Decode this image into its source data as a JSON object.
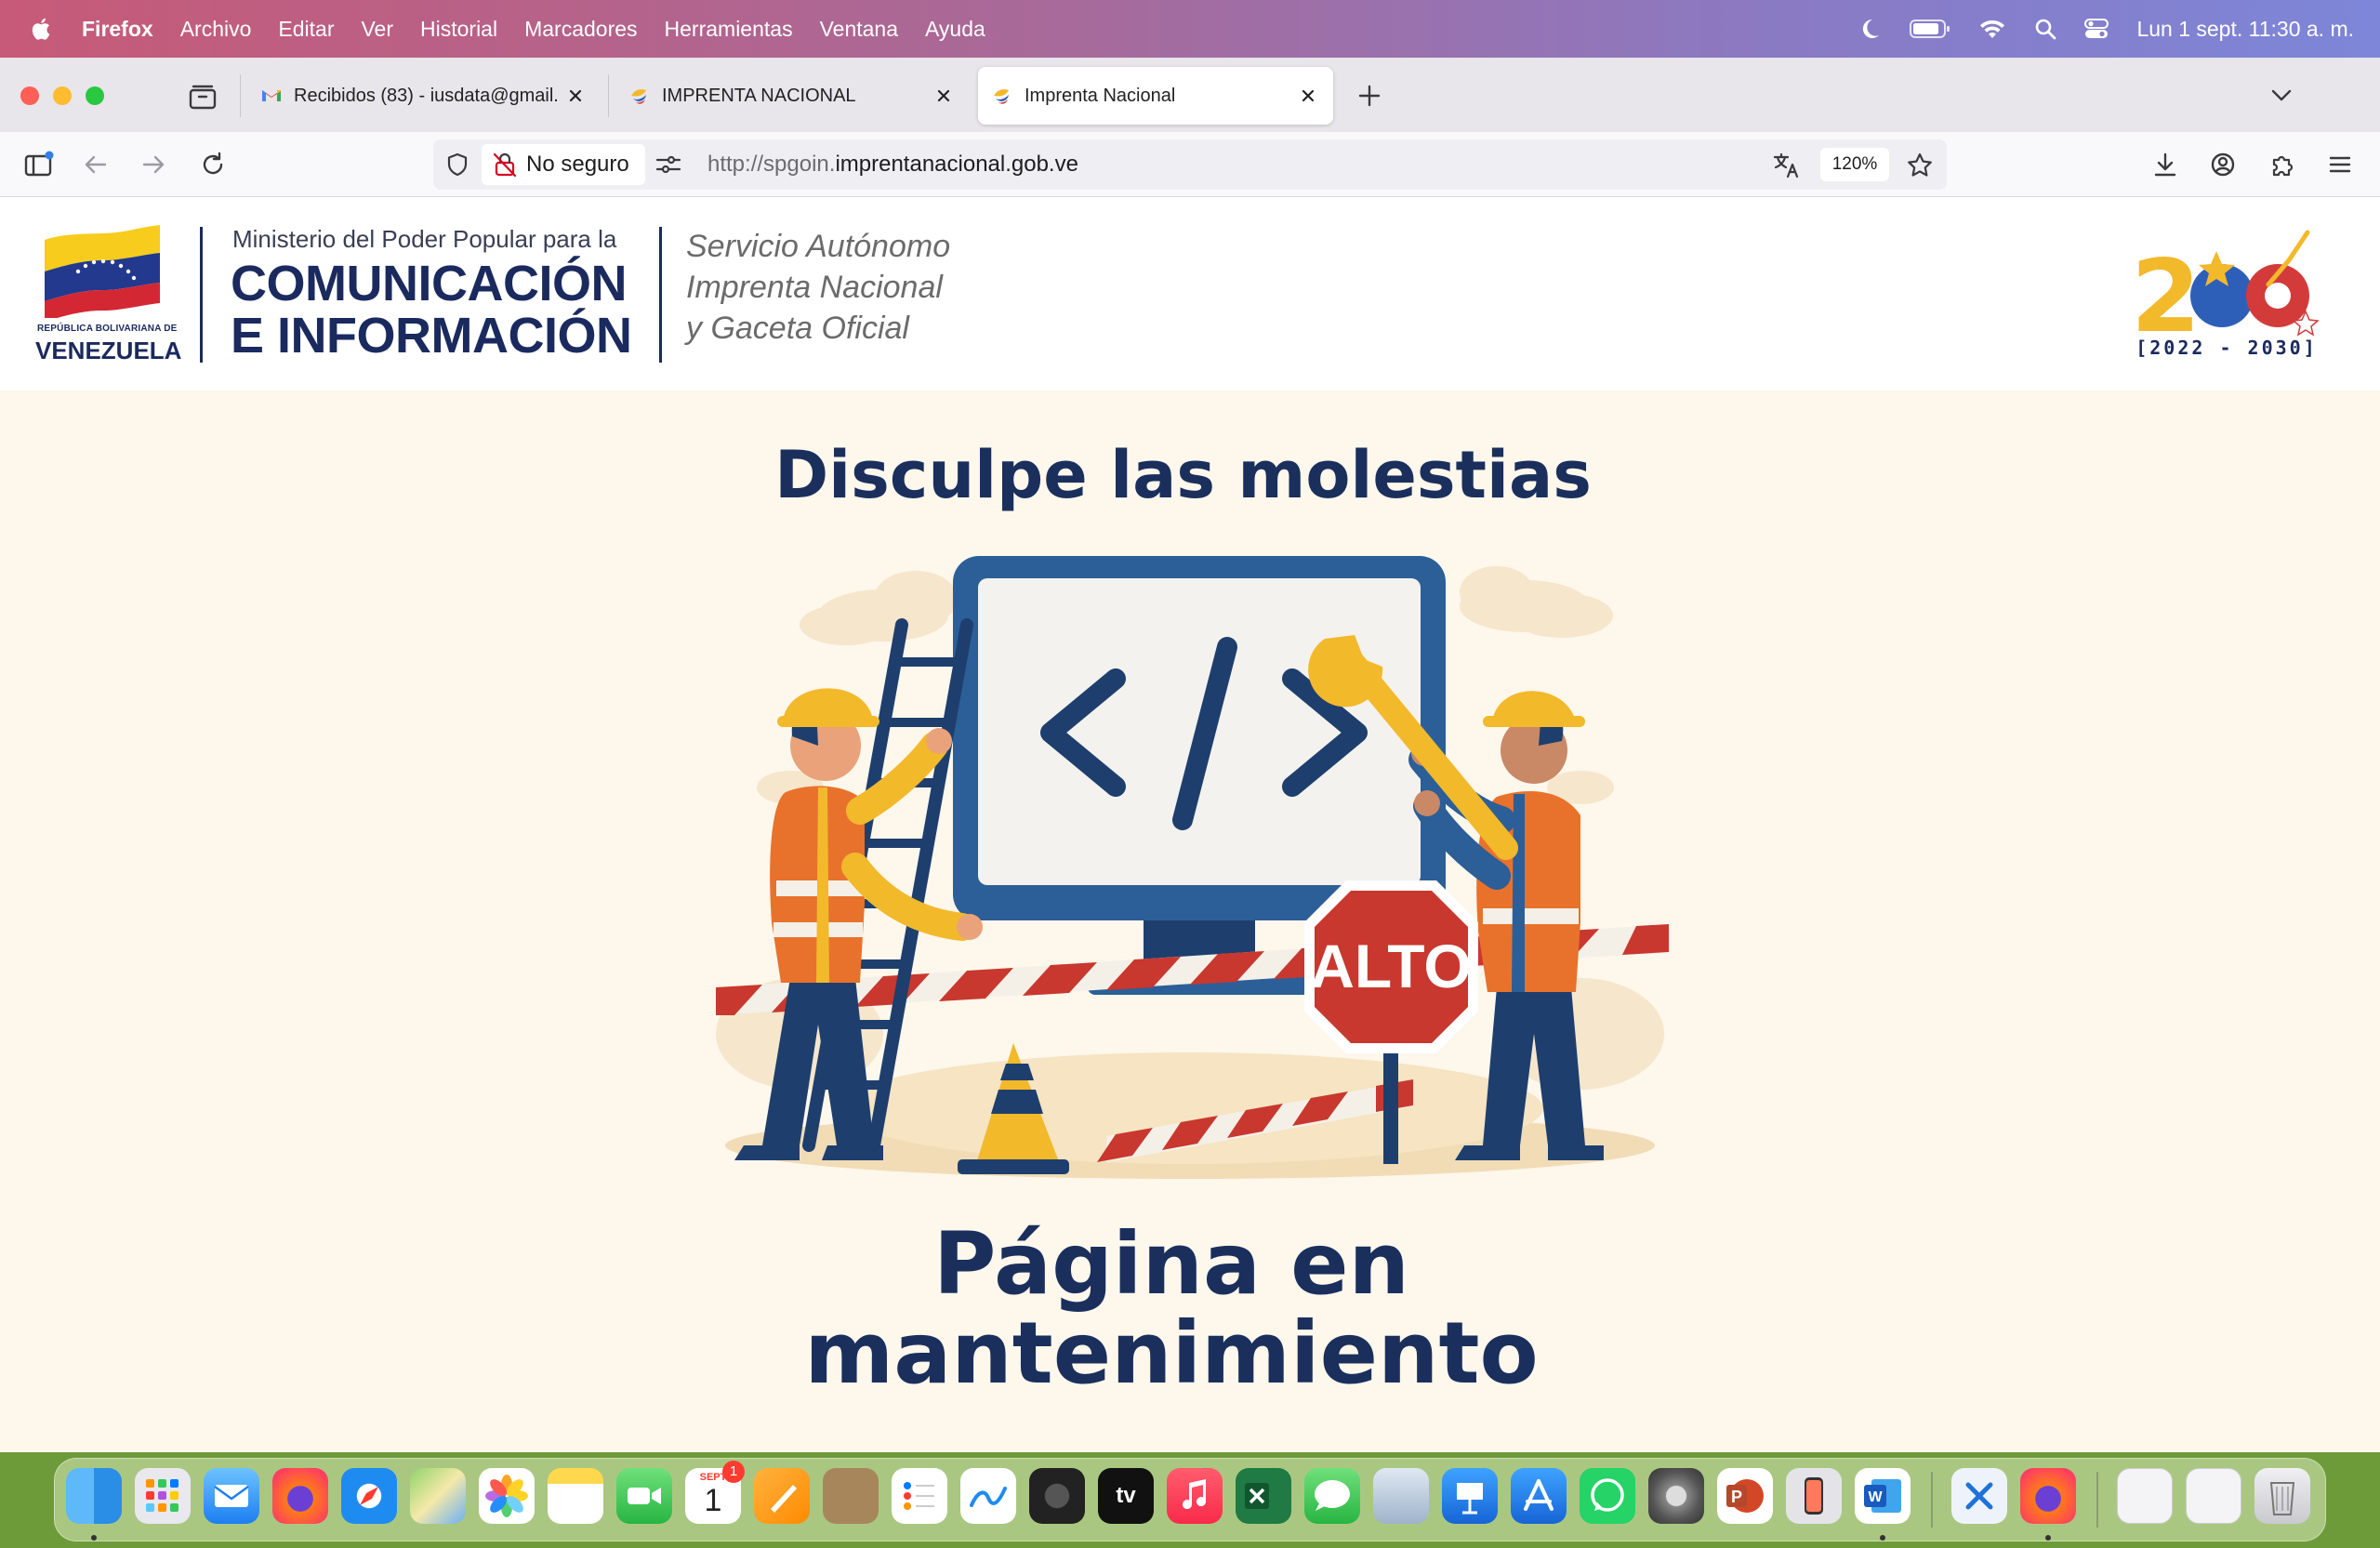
{
  "menubar": {
    "items": [
      "Firefox",
      "Archivo",
      "Editar",
      "Ver",
      "Historial",
      "Marcadores",
      "Herramientas",
      "Ventana",
      "Ayuda"
    ],
    "datetime": "Lun 1 sept.  11:30 a. m."
  },
  "tabs": [
    {
      "label": "Recibidos (83) - iusdata@gmail.",
      "favicon": "gmail-icon"
    },
    {
      "label": "IMPRENTA NACIONAL",
      "favicon": "imprenta-icon"
    },
    {
      "label": "Imprenta Nacional",
      "favicon": "imprenta-icon",
      "active": true
    }
  ],
  "toolbar": {
    "security_label": "No seguro",
    "url_protocol": "http://spgoin.",
    "url_domain": "imprentanacional.gob.ve",
    "zoom": "120%"
  },
  "header": {
    "country_small": "REPÚBLICA BOLIVARIANA DE",
    "country": "VENEZUELA",
    "ministry_top": "Ministerio del Poder Popular para la",
    "ministry_line1": "COMUNICACIÓN",
    "ministry_line2": "E INFORMACIÓN",
    "service_line1": "Servicio Autónomo",
    "service_line2": "Imprenta Nacional",
    "service_line3": "y Gaceta Oficial",
    "years": "[2022 - 2030]"
  },
  "main": {
    "title": "Disculpe las molestias",
    "stop_sign": "ALTO",
    "code_symbol": "</>",
    "subtitle_line1": "Página en",
    "subtitle_line2": "mantenimiento"
  },
  "colors": {
    "navy": "#1a2f5c",
    "page_bg": "#fdf7ec",
    "stop_red": "#c8382e",
    "helmet_yellow": "#f2b92b",
    "vest_orange": "#e8722c"
  },
  "dock": {
    "calendar_month": "SEPT",
    "calendar_day": "1",
    "calendar_badge": "1"
  }
}
